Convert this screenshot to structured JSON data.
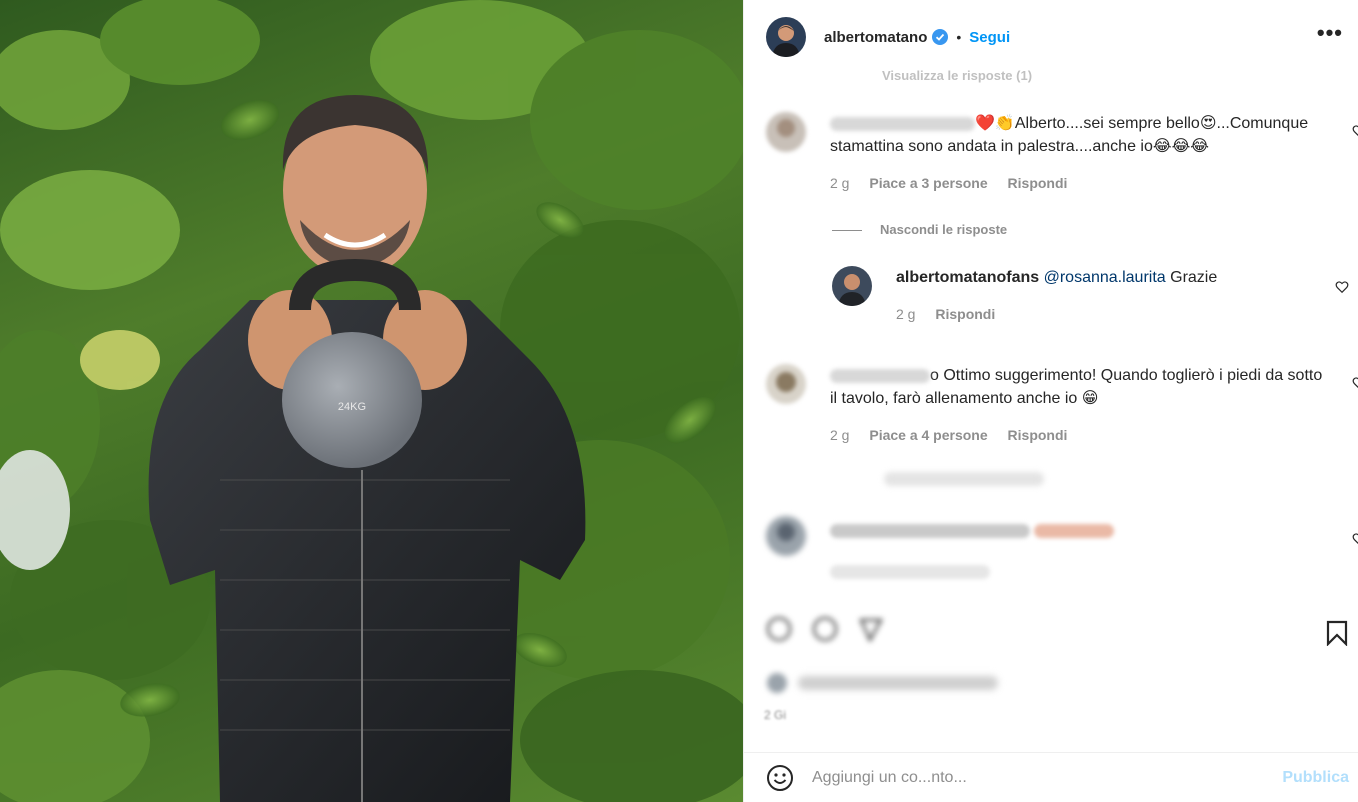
{
  "header": {
    "username": "albertomatano",
    "separator": "•",
    "follow_label": "Segui",
    "more_label": "•••"
  },
  "thread": {
    "view_replies": "Visualizza le risposte (1)",
    "hide_replies": "Nascondi le risposte"
  },
  "comments": [
    {
      "text_emoji": "❤️👏",
      "text": "Alberto....sei sempre bello😍...Comunque stamattina sono andata in palestra....anche io😂😂😂",
      "time": "2 g",
      "likes": "Piace a 3 persone",
      "reply": "Rispondi"
    },
    {
      "user": "albertomatanofans",
      "mention": "@rosanna.laurita",
      "text": " Grazie",
      "time": "2 g",
      "reply": "Rispondi"
    },
    {
      "user_tail": "o",
      "text": "Ottimo suggerimento! Quando toglierò i piedi da sotto il tavolo, farò allenamento anche io 😁",
      "time": "2 g",
      "likes": "Piace a 4 persone",
      "reply": "Rispondi"
    }
  ],
  "post": {
    "kettlebell_label": "24KG",
    "date": "2 Gi"
  },
  "add_comment": {
    "emoji_icon": "smiley-icon",
    "placeholder": "Aggiungi un co...nto...",
    "publish_label": "Pubblica"
  },
  "colors": {
    "accent": "#0095f6",
    "publish_disabled": "#b2dffc",
    "muted": "#8e8e8e",
    "verified": "#3897f0"
  }
}
